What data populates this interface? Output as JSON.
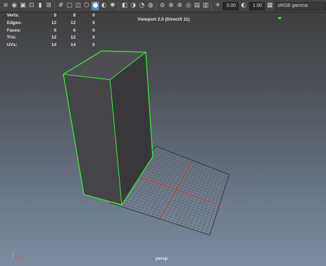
{
  "toolbar": {
    "icons": [
      "viewport-menu-icon",
      "camera-icon",
      "frame-all-icon",
      "frame-selected-icon",
      "bookmark-icon",
      "film-icon",
      "grid-icon",
      "resolution-gate-icon",
      "safe-area-icon",
      "wireframe-icon",
      "smooth-shade-icon",
      "textured-icon",
      "lights-icon",
      "shadows-icon",
      "ambient-occlusion-icon",
      "motion-blur-icon",
      "antialias-icon",
      "xray-icon",
      "isolate-icon",
      "xray-joints-icon",
      "xray-active-icon",
      "camera-attrs-icon",
      "image-plane-icon",
      "exposure-icon"
    ],
    "exposure_value": "0.00",
    "gamma_value": "1.00",
    "color_space": "sRGB gamma"
  },
  "hud": {
    "rows": [
      {
        "label": "Verts:",
        "c1": "8",
        "c2": "8",
        "c3": "0"
      },
      {
        "label": "Edges:",
        "c1": "12",
        "c2": "12",
        "c3": "0"
      },
      {
        "label": "Faces:",
        "c1": "6",
        "c2": "6",
        "c3": "0"
      },
      {
        "label": "Tris:",
        "c1": "12",
        "c2": "12",
        "c3": "0"
      },
      {
        "label": "UVs:",
        "c1": "14",
        "c2": "14",
        "c3": "0"
      }
    ],
    "renderer": "Viewport 2.0 (DirectX 11)",
    "camera": "persp"
  },
  "colors": {
    "selection": "#3cf03c",
    "grid_axis": "#c0392b",
    "active_button": "#5a86b0"
  }
}
